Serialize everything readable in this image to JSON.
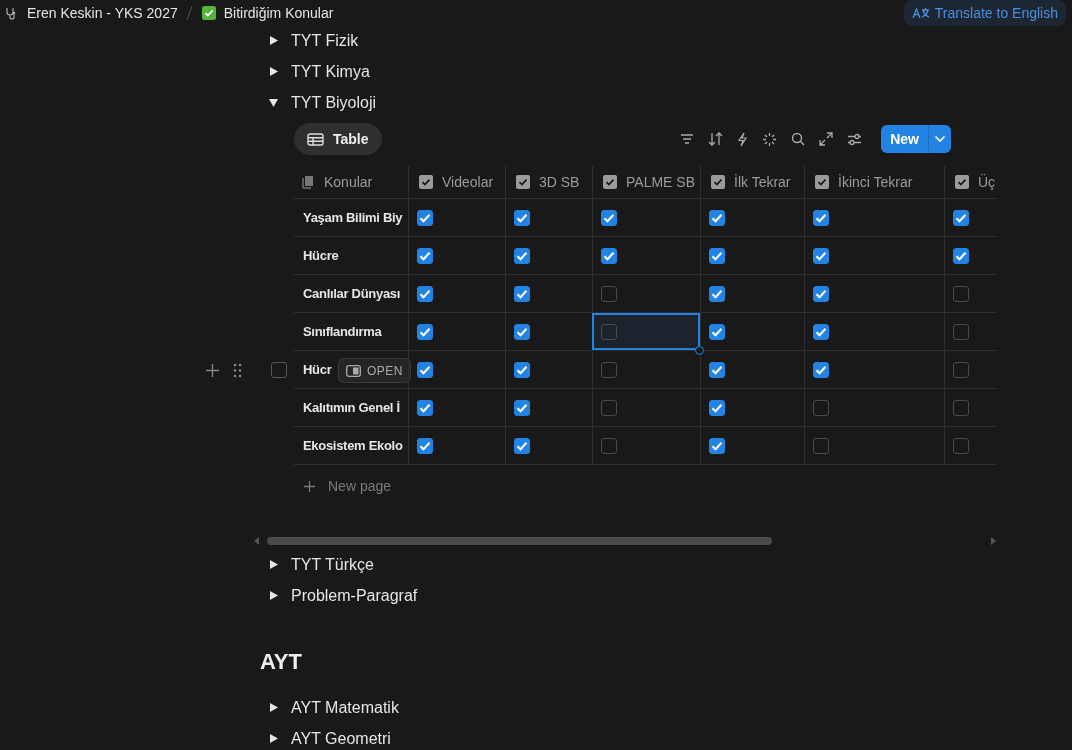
{
  "breadcrumb": {
    "workspace": "Eren Keskin - YKS 2027",
    "page": "Bitirdiğim Konular"
  },
  "translate_button": "Translate to English",
  "toggles_top": [
    {
      "label": "TYT Fizik",
      "expanded": false
    },
    {
      "label": "TYT Kimya",
      "expanded": false
    },
    {
      "label": "TYT Biyoloji",
      "expanded": true
    }
  ],
  "view_tab": "Table",
  "new_button": "New",
  "columns": [
    {
      "label": "Konular",
      "kind": "title"
    },
    {
      "label": "Videolar",
      "kind": "checkbox"
    },
    {
      "label": "3D SB",
      "kind": "checkbox"
    },
    {
      "label": "PALME SB",
      "kind": "checkbox"
    },
    {
      "label": "İlk Tekrar",
      "kind": "checkbox"
    },
    {
      "label": "İkinci Tekrar",
      "kind": "checkbox"
    },
    {
      "label": "Üç",
      "kind": "checkbox"
    }
  ],
  "rows": [
    {
      "name": "Yaşam Bilimi Biy",
      "cells": [
        {
          "checked": true,
          "selected": false
        },
        {
          "checked": true,
          "selected": false
        },
        {
          "checked": true,
          "selected": false
        },
        {
          "checked": true,
          "selected": false
        },
        {
          "checked": true,
          "selected": false
        },
        {
          "checked": true,
          "selected": false
        }
      ]
    },
    {
      "name": "Hücre",
      "cells": [
        {
          "checked": true,
          "selected": false
        },
        {
          "checked": true,
          "selected": false
        },
        {
          "checked": true,
          "selected": false
        },
        {
          "checked": true,
          "selected": false
        },
        {
          "checked": true,
          "selected": false
        },
        {
          "checked": true,
          "selected": false
        }
      ]
    },
    {
      "name": "Canlılar Dünyası",
      "cells": [
        {
          "checked": true,
          "selected": false
        },
        {
          "checked": true,
          "selected": false
        },
        {
          "checked": false,
          "selected": false
        },
        {
          "checked": true,
          "selected": false
        },
        {
          "checked": true,
          "selected": false
        },
        {
          "checked": false,
          "selected": false
        }
      ]
    },
    {
      "name": "Sınıflandırma",
      "cells": [
        {
          "checked": true,
          "selected": false
        },
        {
          "checked": true,
          "selected": false
        },
        {
          "checked": false,
          "selected": true
        },
        {
          "checked": true,
          "selected": false
        },
        {
          "checked": true,
          "selected": false
        },
        {
          "checked": false,
          "selected": false
        }
      ]
    },
    {
      "name": "Hücr",
      "open_button": "OPEN",
      "row_checked": false,
      "cells": [
        {
          "checked": true,
          "selected": false
        },
        {
          "checked": true,
          "selected": false
        },
        {
          "checked": false,
          "selected": false
        },
        {
          "checked": true,
          "selected": false
        },
        {
          "checked": true,
          "selected": false
        },
        {
          "checked": false,
          "selected": false
        }
      ]
    },
    {
      "name": "Kalıtımın Genel İ",
      "cells": [
        {
          "checked": true,
          "selected": false
        },
        {
          "checked": true,
          "selected": false
        },
        {
          "checked": false,
          "selected": false
        },
        {
          "checked": true,
          "selected": false
        },
        {
          "checked": false,
          "selected": false
        },
        {
          "checked": false,
          "selected": false
        }
      ]
    },
    {
      "name": "Ekosistem Ekolo",
      "cells": [
        {
          "checked": true,
          "selected": false
        },
        {
          "checked": true,
          "selected": false
        },
        {
          "checked": false,
          "selected": false
        },
        {
          "checked": true,
          "selected": false
        },
        {
          "checked": false,
          "selected": false
        },
        {
          "checked": false,
          "selected": false
        }
      ]
    }
  ],
  "new_page": "New page",
  "toggles_after": [
    {
      "label": "TYT Türkçe",
      "expanded": false
    },
    {
      "label": "Problem-Paragraf",
      "expanded": false
    }
  ],
  "section_heading": "AYT",
  "toggles_ayt": [
    {
      "label": "AYT Matematik",
      "expanded": false
    },
    {
      "label": "AYT Geometri",
      "expanded": false
    }
  ]
}
